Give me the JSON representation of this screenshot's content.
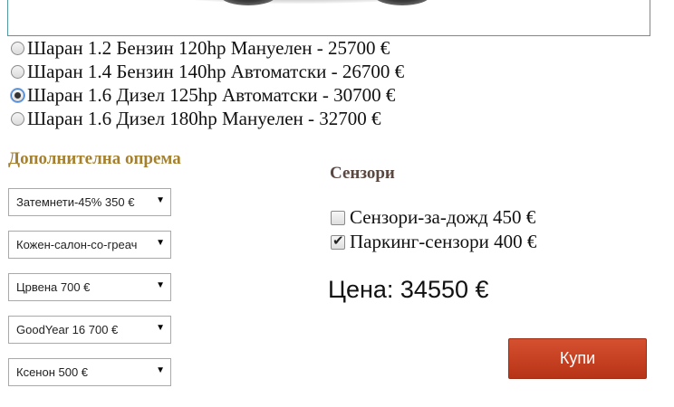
{
  "variants": [
    {
      "label": "Шаран 1.2 Бензин 120hp Мануелен - 25700 €",
      "selected": false
    },
    {
      "label": "Шаран 1.4 Бензин 140hp Автоматски - 26700 €",
      "selected": false
    },
    {
      "label": "Шаран 1.6 Дизел 125hp Автоматски - 30700 €",
      "selected": true
    },
    {
      "label": "Шаран 1.6 Дизел 180hp Мануелен - 32700 €",
      "selected": false
    }
  ],
  "equipment": {
    "title": "Дополнителна опрема",
    "selects": [
      {
        "value": "Затемнети-45% 350 €"
      },
      {
        "value": "Кожен-салон-со-греач"
      },
      {
        "value": "Црвена 700 €"
      },
      {
        "value": "GoodYear 16 700 €"
      },
      {
        "value": "Ксенон 500 €"
      }
    ]
  },
  "sensors": {
    "title": "Сензори",
    "items": [
      {
        "label": "Сензори-за-дожд 450 €",
        "checked": false
      },
      {
        "label": "Паркинг-сензори 400 €",
        "checked": true
      }
    ]
  },
  "price": {
    "text": "Цена: 34550 €"
  },
  "buy": {
    "label": "Купи"
  },
  "colors": {
    "accent_title": "#a5812f",
    "buy_button": "#c8421f",
    "frame_border": "#4f9aa3"
  }
}
